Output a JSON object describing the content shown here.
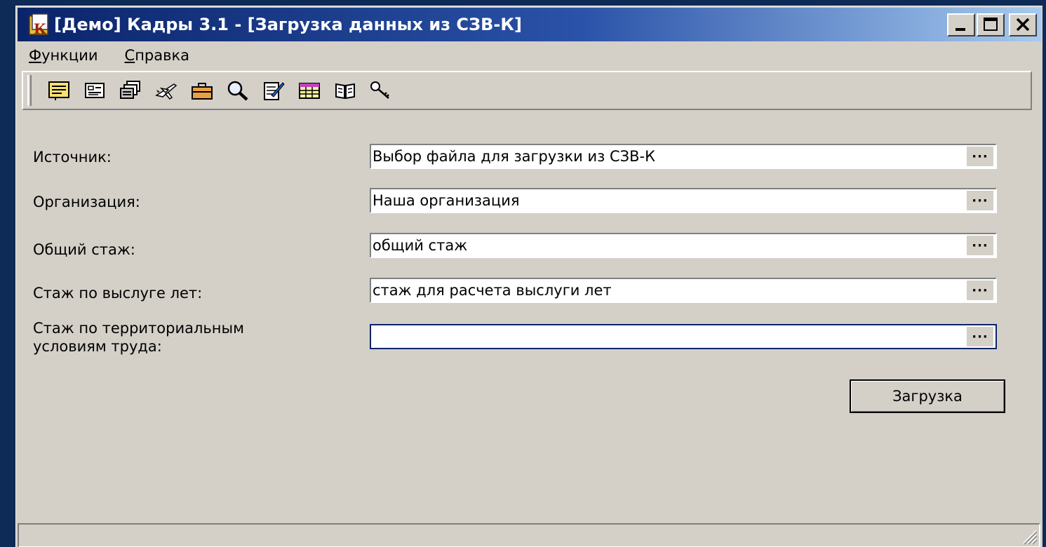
{
  "window": {
    "title": "[Демо] Кадры 3.1 - [Загрузка данных из СЗВ-К]",
    "buttons": [
      "minimize",
      "maximize",
      "close"
    ]
  },
  "menu": {
    "items": [
      {
        "label": "Функции",
        "underline": "Ф"
      },
      {
        "label": "Справка",
        "underline": "С"
      }
    ]
  },
  "toolbar": {
    "icons": [
      "document-list-icon",
      "card-icon",
      "documents-stack-icon",
      "airplane-icon",
      "briefcase-icon",
      "search-icon",
      "edit-document-icon",
      "table-icon",
      "book-icon",
      "keys-icon"
    ]
  },
  "form": {
    "fields": [
      {
        "label": "Источник:",
        "value": "Выбор файла для загрузки из СЗВ-К"
      },
      {
        "label": "Организация:",
        "value": "Наша организация"
      },
      {
        "label": "Общий стаж:",
        "value": "общий стаж"
      },
      {
        "label": "Стаж по выслуге лет:",
        "value": "стаж для расчета выслуги лет"
      },
      {
        "label_line1": "Стаж по территориальным",
        "label_line2": "условиям труда:",
        "value": ""
      }
    ],
    "browse_label": "···",
    "submit_label": "Загрузка"
  },
  "colors": {
    "title_start": "#0a246a",
    "title_end": "#a6caf0",
    "face": "#d4d0c8",
    "desktop": "#0e2a57"
  }
}
